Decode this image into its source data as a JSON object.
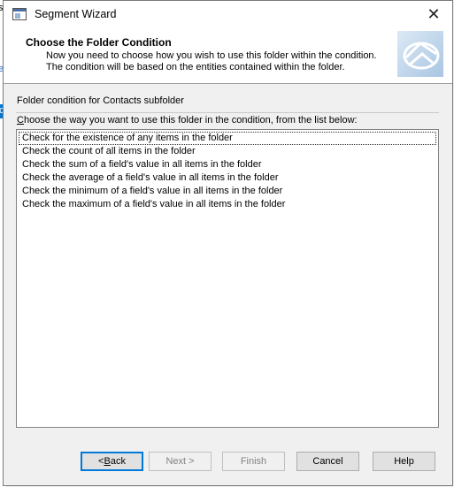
{
  "background": {
    "fragments": [
      "s",
      "ep"
    ],
    "highlight_fragment": "ch"
  },
  "window": {
    "title": "Segment Wizard",
    "close_glyph": "✕"
  },
  "header": {
    "title": "Choose the Folder Condition",
    "description": "Now you need to choose how you wish to use this folder within the condition.  The condition will be based on the entities contained within the folder."
  },
  "body": {
    "folder_label": "Folder condition for Contacts subfolder",
    "instruction_prefix": "",
    "instruction_mnemonic": "C",
    "instruction_rest": "hoose the way you want to use this folder in the condition, from the list below:",
    "options": [
      "Check for the existence of any items in the folder",
      "Check the count of all items in the folder",
      "Check the sum of a field's value in all items in the folder",
      "Check the average of a field's value in all items in the folder",
      "Check the minimum of a field's value in all items in the folder",
      "Check the maximum of a field's value in all items in the folder"
    ]
  },
  "buttons": {
    "back": {
      "prefix": "< ",
      "mnemonic": "B",
      "rest": "ack",
      "enabled": true
    },
    "next": {
      "label": "Next >",
      "enabled": false
    },
    "finish": {
      "label": "Finish",
      "enabled": false
    },
    "cancel": {
      "label": "Cancel",
      "enabled": true
    },
    "help": {
      "label": "Help",
      "enabled": true
    }
  },
  "colors": {
    "accent": "#0078d7",
    "dialog_bg": "#f0f0f0",
    "disabled_text": "#838383"
  }
}
